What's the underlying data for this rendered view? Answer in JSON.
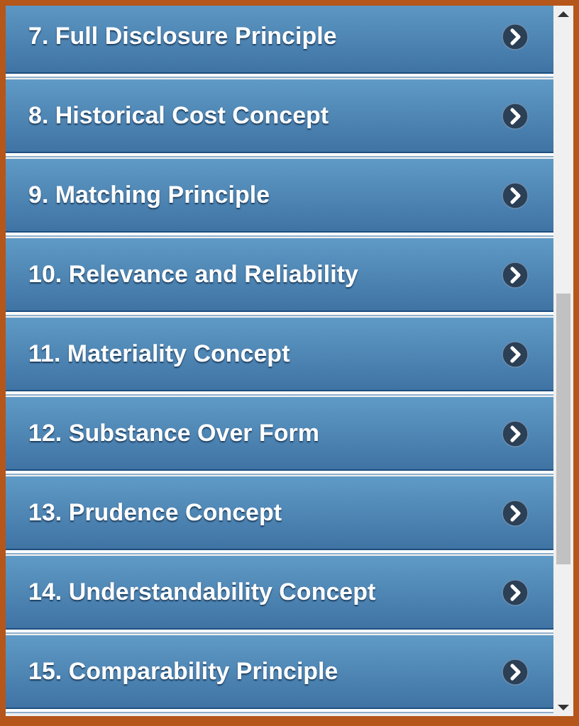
{
  "items": [
    {
      "label": "7. Full Disclosure Principle"
    },
    {
      "label": "8. Historical Cost Concept"
    },
    {
      "label": "9. Matching Principle"
    },
    {
      "label": "10. Relevance and Reliability"
    },
    {
      "label": "11. Materiality Concept"
    },
    {
      "label": "12. Substance Over Form"
    },
    {
      "label": "13. Prudence Concept"
    },
    {
      "label": "14. Understandability Concept"
    },
    {
      "label": "15. Comparability Principle"
    }
  ]
}
